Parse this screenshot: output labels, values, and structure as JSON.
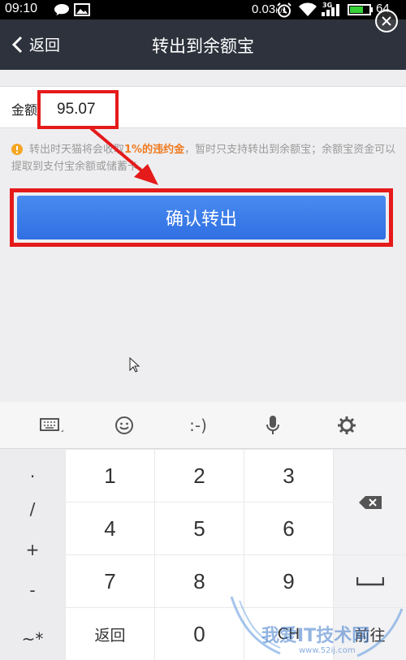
{
  "status_bar": {
    "time": "09:10",
    "net_speed": "0.03",
    "net_speed_unit": "K/s",
    "network_type": "3G",
    "battery_text": "64"
  },
  "nav": {
    "back_label": "返回",
    "title": "转出到余额宝"
  },
  "form": {
    "amount_label": "金额",
    "amount_value": "95.07"
  },
  "notice": {
    "text_before": "转出时天猫将会收取",
    "highlight": "1%的违约金",
    "text_after": "，暂时只支持转出到余额宝；余额宝资金可以提取到支付宝余额或储蓄卡。"
  },
  "confirm_button": "确认转出",
  "keyboard": {
    "toolbar": [
      {
        "icon": "keyboard-icon"
      },
      {
        "icon": "smiley-icon"
      },
      {
        "label": ":-)"
      },
      {
        "icon": "microphone-icon"
      },
      {
        "icon": "gear-icon"
      }
    ],
    "symbols": [
      ".",
      "/",
      "+",
      "-",
      "~*"
    ],
    "digits": [
      "1",
      "2",
      "3",
      "4",
      "5",
      "6",
      "7",
      "8",
      "9",
      "0"
    ],
    "back_label": "返回",
    "lang_label": "CH",
    "go_label": "前往"
  },
  "watermark": {
    "text": "我爱IT技术网",
    "url": "www.52ij.com"
  },
  "colors": {
    "annotation_red": "#e51a1a",
    "button_blue": "#3a7ae8",
    "nav_bg": "#2d323c",
    "notice_highlight": "#f07a20"
  }
}
